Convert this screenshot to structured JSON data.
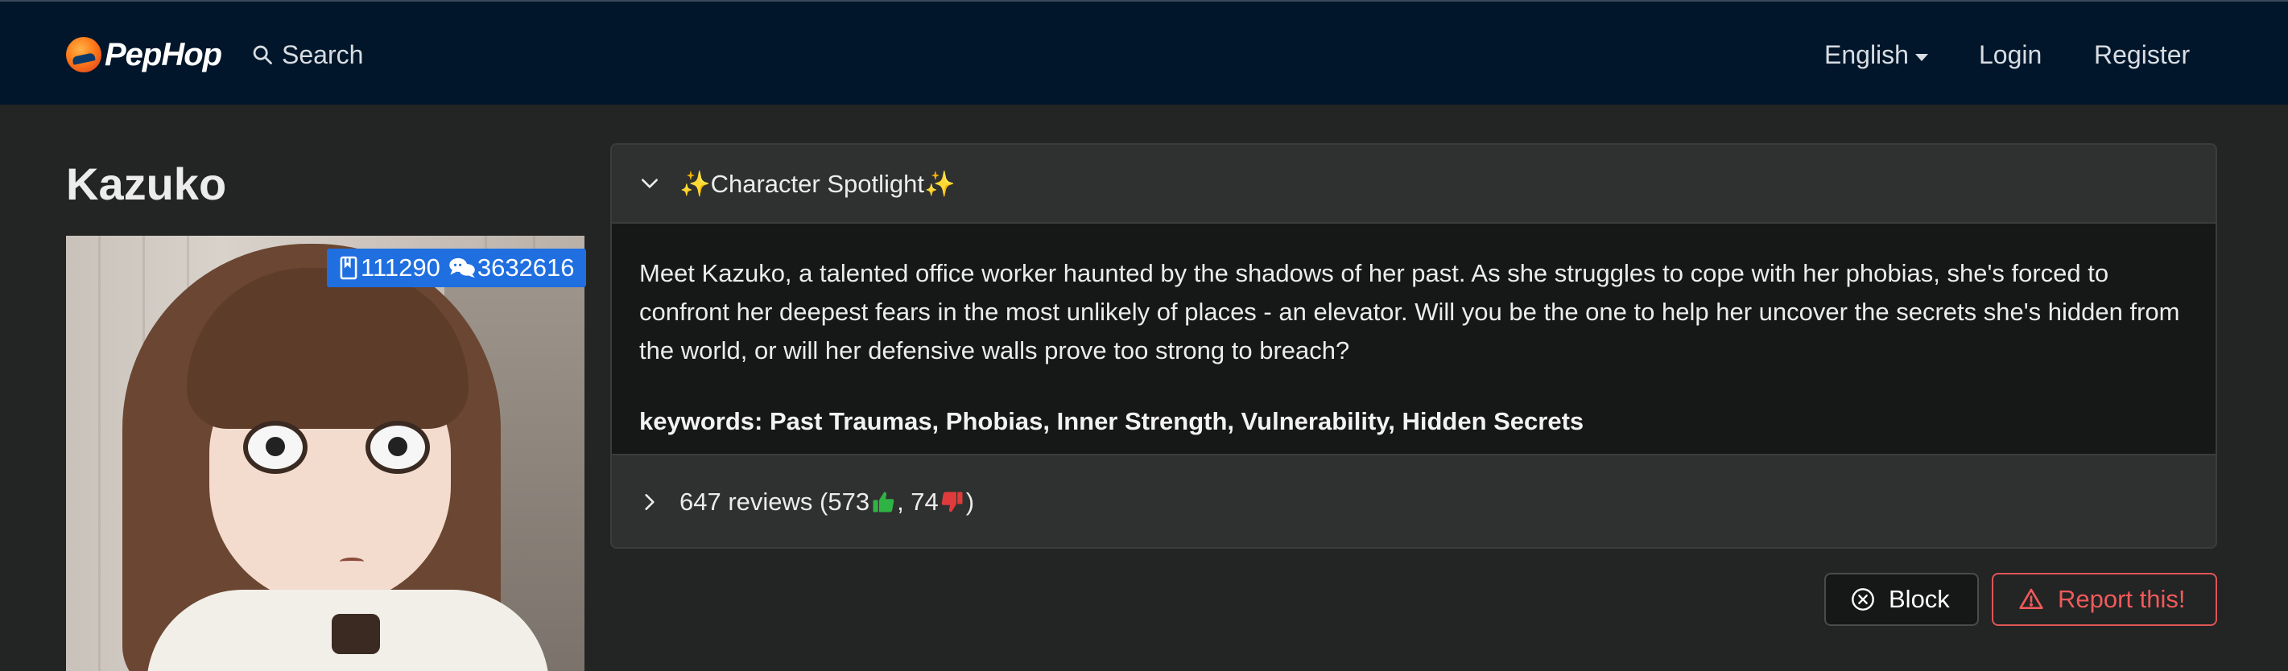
{
  "nav": {
    "logo_text": "PepHop",
    "search_label": "Search",
    "language": "English",
    "login": "Login",
    "register": "Register"
  },
  "character": {
    "name": "Kazuko",
    "stats": {
      "messages": "111290",
      "chats": "3632616"
    }
  },
  "spotlight": {
    "title": "✨Character Spotlight✨",
    "description": "Meet Kazuko, a talented office worker haunted by the shadows of her past. As she struggles to cope with her phobias, she's forced to confront her deepest fears in the most unlikely of places - an elevator. Will you be the one to help her uncover the secrets she's hidden from the world, or will her defensive walls prove too strong to breach?",
    "keywords": "keywords: Past Traumas, Phobias, Inner Strength, Vulnerability, Hidden Secrets"
  },
  "reviews": {
    "prefix": "647 reviews (573",
    "separator": ", 74",
    "suffix": ")",
    "positive_color": "#2fb344",
    "negative_color": "#e03b3b"
  },
  "actions": {
    "block": "Block",
    "report": "Report this!"
  },
  "colors": {
    "navbar_bg": "#01162a",
    "page_bg": "#232424",
    "badge_bg": "#1f6fe0",
    "report_red": "#ef5a5b"
  }
}
